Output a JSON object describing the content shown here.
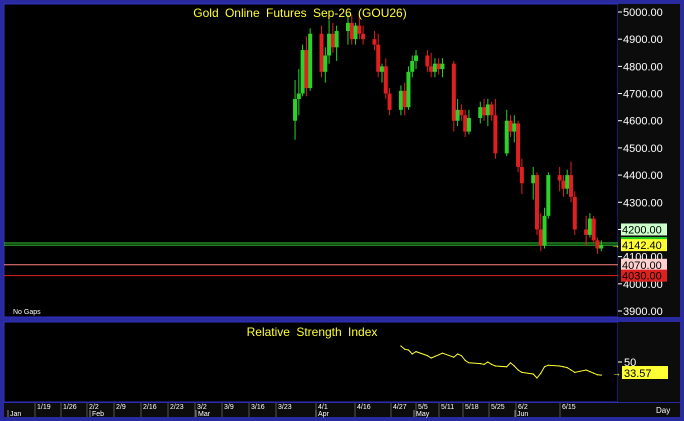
{
  "colors": {
    "background": "#000000",
    "frame": "#2a2aa0",
    "panel_border": "#3030c0",
    "axis_bg": "#0c0c0c",
    "up": "#2ad22a",
    "down": "#e02020",
    "title": "#ffff33",
    "rsi_line": "#ffff33",
    "axis_text": "#ffffff"
  },
  "price_panel": {
    "title": "Gold Online Futures Sep-26 (GOU26)",
    "note": "No Gaps",
    "y_ticks": [
      "5000.00",
      "4900.00",
      "4800.00",
      "4700.00",
      "4600.00",
      "4500.00",
      "4400.00",
      "4300.00",
      "4200.00",
      "4100.00",
      "4000.00",
      "3900.00"
    ],
    "level_labels": [
      {
        "value": 4200.0,
        "text": "4200.00",
        "line": "#33cc33",
        "box_bg": "#ccffcc",
        "box_fg": "#000000",
        "draw_line": false
      },
      {
        "value": 4150.0,
        "text": "4150.00",
        "line": "#33cc33",
        "box_bg": "#22cc22",
        "box_fg": "#000000",
        "draw_line": true
      },
      {
        "value": 4142.4,
        "text": "4142.40",
        "line": "#ffff33",
        "box_bg": "#ffff33",
        "box_fg": "#000000",
        "draw_line": false
      },
      {
        "value": 4070.0,
        "text": "4070.00",
        "line": "#ff8080",
        "box_bg": "#ffd0d0",
        "box_fg": "#000000",
        "draw_line": true
      },
      {
        "value": 4030.0,
        "text": "4030.00",
        "line": "#dd2020",
        "box_bg": "#dd2020",
        "box_fg": "#000000",
        "draw_line": true
      }
    ]
  },
  "rsi_panel": {
    "title": "Relative Strength Index",
    "y_ticks": [
      "50"
    ],
    "last_label": "33.57"
  },
  "x_axis": {
    "week_labels": [
      "1/19",
      "1/26",
      "2/2",
      "2/9",
      "2/16",
      "2/23",
      "3/2",
      "3/9",
      "3/16",
      "3/23",
      "4/1",
      "4/16",
      "4/27",
      "5/5",
      "5/11",
      "5/18",
      "5/25",
      "6/2",
      "6/15"
    ],
    "month_labels": [
      "Jan",
      "Feb",
      "Mar",
      "Apr",
      "May",
      "Jun"
    ],
    "interval_label": "Day"
  },
  "chart_data": [
    {
      "type": "candlestick",
      "title": "Gold Online Futures Sep-26 (GOU26)",
      "ylim": [
        3900,
        5000
      ],
      "x_start": "2026-03-30",
      "x_end": "2026-06-22",
      "level_lines": [
        4200.0,
        4150.0,
        4142.4,
        4070.0,
        4030.0
      ],
      "last": 4142.4,
      "candles": [
        {
          "date": "2026-03-30",
          "o": 4600,
          "h": 4750,
          "l": 4530,
          "c": 4680
        },
        {
          "date": "2026-03-31",
          "o": 4680,
          "h": 4790,
          "l": 4620,
          "c": 4700
        },
        {
          "date": "2026-04-01",
          "o": 4700,
          "h": 4880,
          "l": 4690,
          "c": 4860
        },
        {
          "date": "2026-04-02",
          "o": 4860,
          "h": 4910,
          "l": 4690,
          "c": 4720
        },
        {
          "date": "2026-04-03",
          "o": 4720,
          "h": 4940,
          "l": 4710,
          "c": 4920
        },
        {
          "date": "2026-04-06",
          "o": 4920,
          "h": 4950,
          "l": 4760,
          "c": 4780
        },
        {
          "date": "2026-04-07",
          "o": 4780,
          "h": 4870,
          "l": 4740,
          "c": 4840
        },
        {
          "date": "2026-04-08",
          "o": 4840,
          "h": 4970,
          "l": 4810,
          "c": 4920
        },
        {
          "date": "2026-04-09",
          "o": 4920,
          "h": 4960,
          "l": 4850,
          "c": 4870
        },
        {
          "date": "2026-04-10",
          "o": 4870,
          "h": 4950,
          "l": 4820,
          "c": 4930
        },
        {
          "date": "2026-04-13",
          "o": 4930,
          "h": 4990,
          "l": 4880,
          "c": 4960
        },
        {
          "date": "2026-04-14",
          "o": 4960,
          "h": 4990,
          "l": 4880,
          "c": 4900
        },
        {
          "date": "2026-04-15",
          "o": 4900,
          "h": 4960,
          "l": 4880,
          "c": 4950
        },
        {
          "date": "2026-04-16",
          "o": 4950,
          "h": 4990,
          "l": 4900,
          "c": 4920
        },
        {
          "date": "2026-04-17",
          "o": 4920,
          "h": 4950,
          "l": 4880,
          "c": 4900
        },
        {
          "date": "2026-04-20",
          "o": 4900,
          "h": 4930,
          "l": 4860,
          "c": 4880
        },
        {
          "date": "2026-04-21",
          "o": 4880,
          "h": 4920,
          "l": 4760,
          "c": 4780
        },
        {
          "date": "2026-04-22",
          "o": 4780,
          "h": 4810,
          "l": 4740,
          "c": 4800
        },
        {
          "date": "2026-04-23",
          "o": 4800,
          "h": 4830,
          "l": 4680,
          "c": 4700
        },
        {
          "date": "2026-04-24",
          "o": 4700,
          "h": 4720,
          "l": 4620,
          "c": 4640
        },
        {
          "date": "2026-04-27",
          "o": 4640,
          "h": 4730,
          "l": 4620,
          "c": 4710
        },
        {
          "date": "2026-04-28",
          "o": 4710,
          "h": 4740,
          "l": 4620,
          "c": 4650
        },
        {
          "date": "2026-04-29",
          "o": 4650,
          "h": 4800,
          "l": 4640,
          "c": 4780
        },
        {
          "date": "2026-04-30",
          "o": 4780,
          "h": 4840,
          "l": 4760,
          "c": 4820
        },
        {
          "date": "2026-05-01",
          "o": 4820,
          "h": 4860,
          "l": 4790,
          "c": 4840
        },
        {
          "date": "2026-05-04",
          "o": 4840,
          "h": 4860,
          "l": 4780,
          "c": 4800
        },
        {
          "date": "2026-05-05",
          "o": 4800,
          "h": 4850,
          "l": 4760,
          "c": 4780
        },
        {
          "date": "2026-05-06",
          "o": 4780,
          "h": 4830,
          "l": 4760,
          "c": 4810
        },
        {
          "date": "2026-05-07",
          "o": 4810,
          "h": 4830,
          "l": 4770,
          "c": 4790
        },
        {
          "date": "2026-05-08",
          "o": 4790,
          "h": 4830,
          "l": 4760,
          "c": 4810
        },
        {
          "date": "2026-05-11",
          "o": 4810,
          "h": 4820,
          "l": 4560,
          "c": 4600
        },
        {
          "date": "2026-05-12",
          "o": 4600,
          "h": 4680,
          "l": 4580,
          "c": 4640
        },
        {
          "date": "2026-05-13",
          "o": 4640,
          "h": 4660,
          "l": 4600,
          "c": 4620
        },
        {
          "date": "2026-05-14",
          "o": 4620,
          "h": 4640,
          "l": 4540,
          "c": 4560
        },
        {
          "date": "2026-05-15",
          "o": 4560,
          "h": 4640,
          "l": 4550,
          "c": 4610
        },
        {
          "date": "2026-05-18",
          "o": 4610,
          "h": 4670,
          "l": 4590,
          "c": 4650
        },
        {
          "date": "2026-05-19",
          "o": 4650,
          "h": 4680,
          "l": 4600,
          "c": 4620
        },
        {
          "date": "2026-05-20",
          "o": 4620,
          "h": 4680,
          "l": 4580,
          "c": 4660
        },
        {
          "date": "2026-05-21",
          "o": 4660,
          "h": 4670,
          "l": 4600,
          "c": 4620
        },
        {
          "date": "2026-05-22",
          "o": 4620,
          "h": 4680,
          "l": 4460,
          "c": 4480
        },
        {
          "date": "2026-05-25",
          "o": 4480,
          "h": 4640,
          "l": 4470,
          "c": 4600
        },
        {
          "date": "2026-05-26",
          "o": 4600,
          "h": 4620,
          "l": 4540,
          "c": 4560
        },
        {
          "date": "2026-05-27",
          "o": 4560,
          "h": 4620,
          "l": 4520,
          "c": 4590
        },
        {
          "date": "2026-05-28",
          "o": 4590,
          "h": 4600,
          "l": 4410,
          "c": 4430
        },
        {
          "date": "2026-05-29",
          "o": 4430,
          "h": 4460,
          "l": 4330,
          "c": 4370
        },
        {
          "date": "2026-06-01",
          "o": 4370,
          "h": 4430,
          "l": 4310,
          "c": 4400
        },
        {
          "date": "2026-06-02",
          "o": 4400,
          "h": 4410,
          "l": 4180,
          "c": 4200
        },
        {
          "date": "2026-06-03",
          "o": 4200,
          "h": 4260,
          "l": 4120,
          "c": 4140
        },
        {
          "date": "2026-06-04",
          "o": 4140,
          "h": 4280,
          "l": 4130,
          "c": 4250
        },
        {
          "date": "2026-06-05",
          "o": 4250,
          "h": 4410,
          "l": 4240,
          "c": 4400
        },
        {
          "date": "2026-06-08",
          "o": 4400,
          "h": 4430,
          "l": 4340,
          "c": 4380
        },
        {
          "date": "2026-06-09",
          "o": 4380,
          "h": 4400,
          "l": 4320,
          "c": 4350
        },
        {
          "date": "2026-06-10",
          "o": 4350,
          "h": 4420,
          "l": 4330,
          "c": 4400
        },
        {
          "date": "2026-06-11",
          "o": 4400,
          "h": 4450,
          "l": 4300,
          "c": 4320
        },
        {
          "date": "2026-06-12",
          "o": 4320,
          "h": 4340,
          "l": 4180,
          "c": 4200
        },
        {
          "date": "2026-06-15",
          "o": 4200,
          "h": 4250,
          "l": 4140,
          "c": 4180
        },
        {
          "date": "2026-06-16",
          "o": 4180,
          "h": 4260,
          "l": 4170,
          "c": 4240
        },
        {
          "date": "2026-06-17",
          "o": 4240,
          "h": 4250,
          "l": 4150,
          "c": 4160
        },
        {
          "date": "2026-06-18",
          "o": 4160,
          "h": 4170,
          "l": 4110,
          "c": 4130
        },
        {
          "date": "2026-06-19",
          "o": 4130,
          "h": 4160,
          "l": 4120,
          "c": 4142.4
        }
      ]
    },
    {
      "type": "line",
      "title": "Relative Strength Index",
      "ylim": [
        0,
        100
      ],
      "last": 33.57,
      "points": [
        {
          "date": "2026-04-27",
          "v": 70
        },
        {
          "date": "2026-04-28",
          "v": 66
        },
        {
          "date": "2026-04-29",
          "v": 65
        },
        {
          "date": "2026-04-30",
          "v": 60
        },
        {
          "date": "2026-05-01",
          "v": 63
        },
        {
          "date": "2026-05-04",
          "v": 58
        },
        {
          "date": "2026-05-05",
          "v": 55
        },
        {
          "date": "2026-05-06",
          "v": 57
        },
        {
          "date": "2026-05-07",
          "v": 59
        },
        {
          "date": "2026-05-08",
          "v": 61
        },
        {
          "date": "2026-05-11",
          "v": 56
        },
        {
          "date": "2026-05-12",
          "v": 60
        },
        {
          "date": "2026-05-13",
          "v": 58
        },
        {
          "date": "2026-05-14",
          "v": 52
        },
        {
          "date": "2026-05-15",
          "v": 49
        },
        {
          "date": "2026-05-18",
          "v": 48
        },
        {
          "date": "2026-05-19",
          "v": 47
        },
        {
          "date": "2026-05-20",
          "v": 50
        },
        {
          "date": "2026-05-21",
          "v": 47
        },
        {
          "date": "2026-05-22",
          "v": 45
        },
        {
          "date": "2026-05-25",
          "v": 44
        },
        {
          "date": "2026-05-26",
          "v": 49
        },
        {
          "date": "2026-05-27",
          "v": 45
        },
        {
          "date": "2026-05-28",
          "v": 40
        },
        {
          "date": "2026-05-29",
          "v": 37
        },
        {
          "date": "2026-06-01",
          "v": 35
        },
        {
          "date": "2026-06-02",
          "v": 30
        },
        {
          "date": "2026-06-03",
          "v": 36
        },
        {
          "date": "2026-06-04",
          "v": 44
        },
        {
          "date": "2026-06-05",
          "v": 46
        },
        {
          "date": "2026-06-08",
          "v": 45
        },
        {
          "date": "2026-06-09",
          "v": 44
        },
        {
          "date": "2026-06-10",
          "v": 43
        },
        {
          "date": "2026-06-11",
          "v": 40
        },
        {
          "date": "2026-06-12",
          "v": 37
        },
        {
          "date": "2026-06-15",
          "v": 40
        },
        {
          "date": "2026-06-16",
          "v": 38
        },
        {
          "date": "2026-06-17",
          "v": 36
        },
        {
          "date": "2026-06-18",
          "v": 34
        },
        {
          "date": "2026-06-19",
          "v": 33.57
        }
      ]
    }
  ]
}
